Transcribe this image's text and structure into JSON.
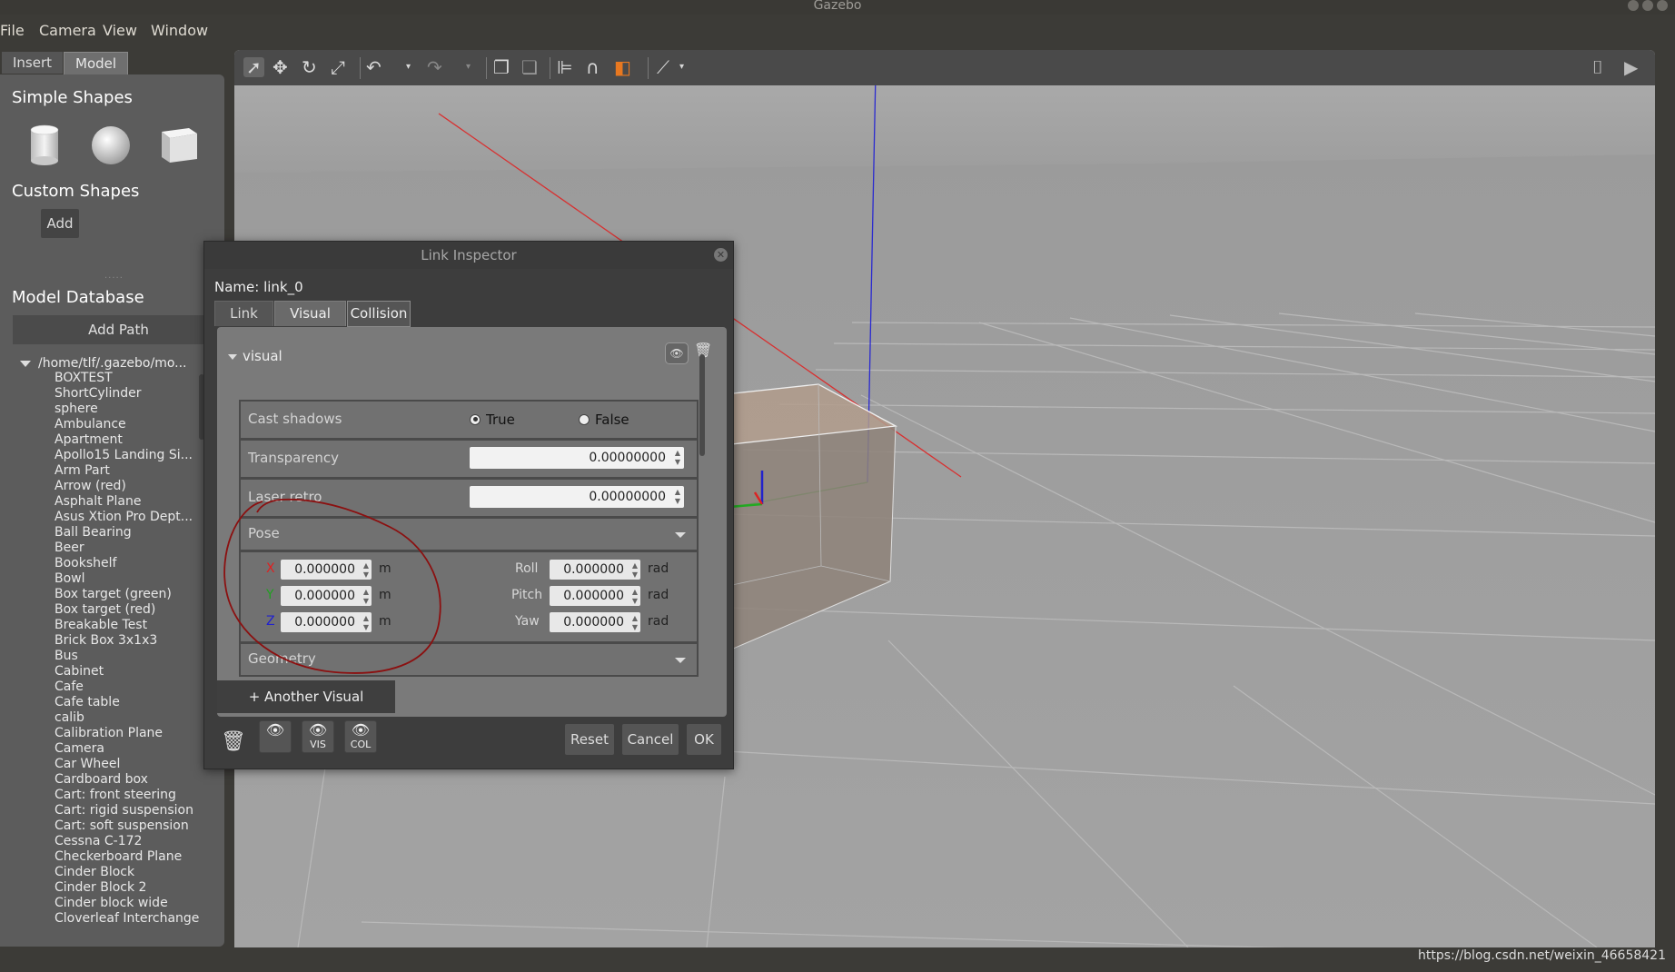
{
  "window": {
    "title": "Gazebo"
  },
  "menu": [
    "File",
    "Camera",
    "View",
    "Window"
  ],
  "left_panel": {
    "tabs": [
      "Insert",
      "Model"
    ],
    "simple_shapes_heading": "Simple Shapes",
    "custom_shapes_heading": "Custom Shapes",
    "add_label": "Add",
    "model_database_heading": "Model Database",
    "add_path_label": "Add Path",
    "tree_root": "/home/tlf/.gazebo/mo...",
    "models": [
      "BOXTEST",
      "ShortCylinder",
      "sphere",
      "Ambulance",
      "Apartment",
      "Apollo15 Landing Si...",
      "Arm Part",
      "Arrow (red)",
      "Asphalt Plane",
      "Asus Xtion Pro Dept...",
      "Ball Bearing",
      "Beer",
      "Bookshelf",
      "Bowl",
      "Box target (green)",
      "Box target (red)",
      "Breakable Test",
      "Brick Box 3x1x3",
      "Bus",
      "Cabinet",
      "Cafe",
      "Cafe table",
      "calib",
      "Calibration Plane",
      "Camera",
      "Car Wheel",
      "Cardboard box",
      "Cart: front steering",
      "Cart: rigid suspension",
      "Cart: soft suspension",
      "Cessna C-172",
      "Checkerboard Plane",
      "Cinder Block",
      "Cinder Block 2",
      "Cinder block wide",
      "Cloverleaf Interchange"
    ]
  },
  "inspector": {
    "title": "Link Inspector",
    "name_label": "Name:",
    "name_value": "link_0",
    "tabs": [
      "Link",
      "Visual",
      "Collision"
    ],
    "visual_name": "visual",
    "cast_shadows_label": "Cast shadows",
    "cast_shadows_true": "True",
    "cast_shadows_false": "False",
    "transparency_label": "Transparency",
    "transparency_value": "0.00000000",
    "laser_retro_label": "Laser retro",
    "laser_retro_value": "0.00000000",
    "pose_label": "Pose",
    "pose": {
      "x_label": "X",
      "y_label": "Y",
      "z_label": "Z",
      "x": "0.000000",
      "y": "0.000000",
      "z": "0.000000",
      "roll_label": "Roll",
      "pitch_label": "Pitch",
      "yaw_label": "Yaw",
      "roll": "0.000000",
      "pitch": "0.000000",
      "yaw": "0.000000",
      "linear_unit": "m",
      "angular_unit": "rad"
    },
    "geometry_label": "Geometry",
    "another_visual_label": "+ Another Visual",
    "eye_vis": "VIS",
    "eye_col": "COL",
    "reset_label": "Reset",
    "cancel_label": "Cancel",
    "ok_label": "OK"
  },
  "watermark": "https://blog.csdn.net/weixin_46658421",
  "colors": {
    "axis_x": "#e02020",
    "axis_y": "#20a020",
    "axis_z": "#2020d0",
    "box_fill": "#8f8177",
    "annotation": "#8b1010"
  }
}
